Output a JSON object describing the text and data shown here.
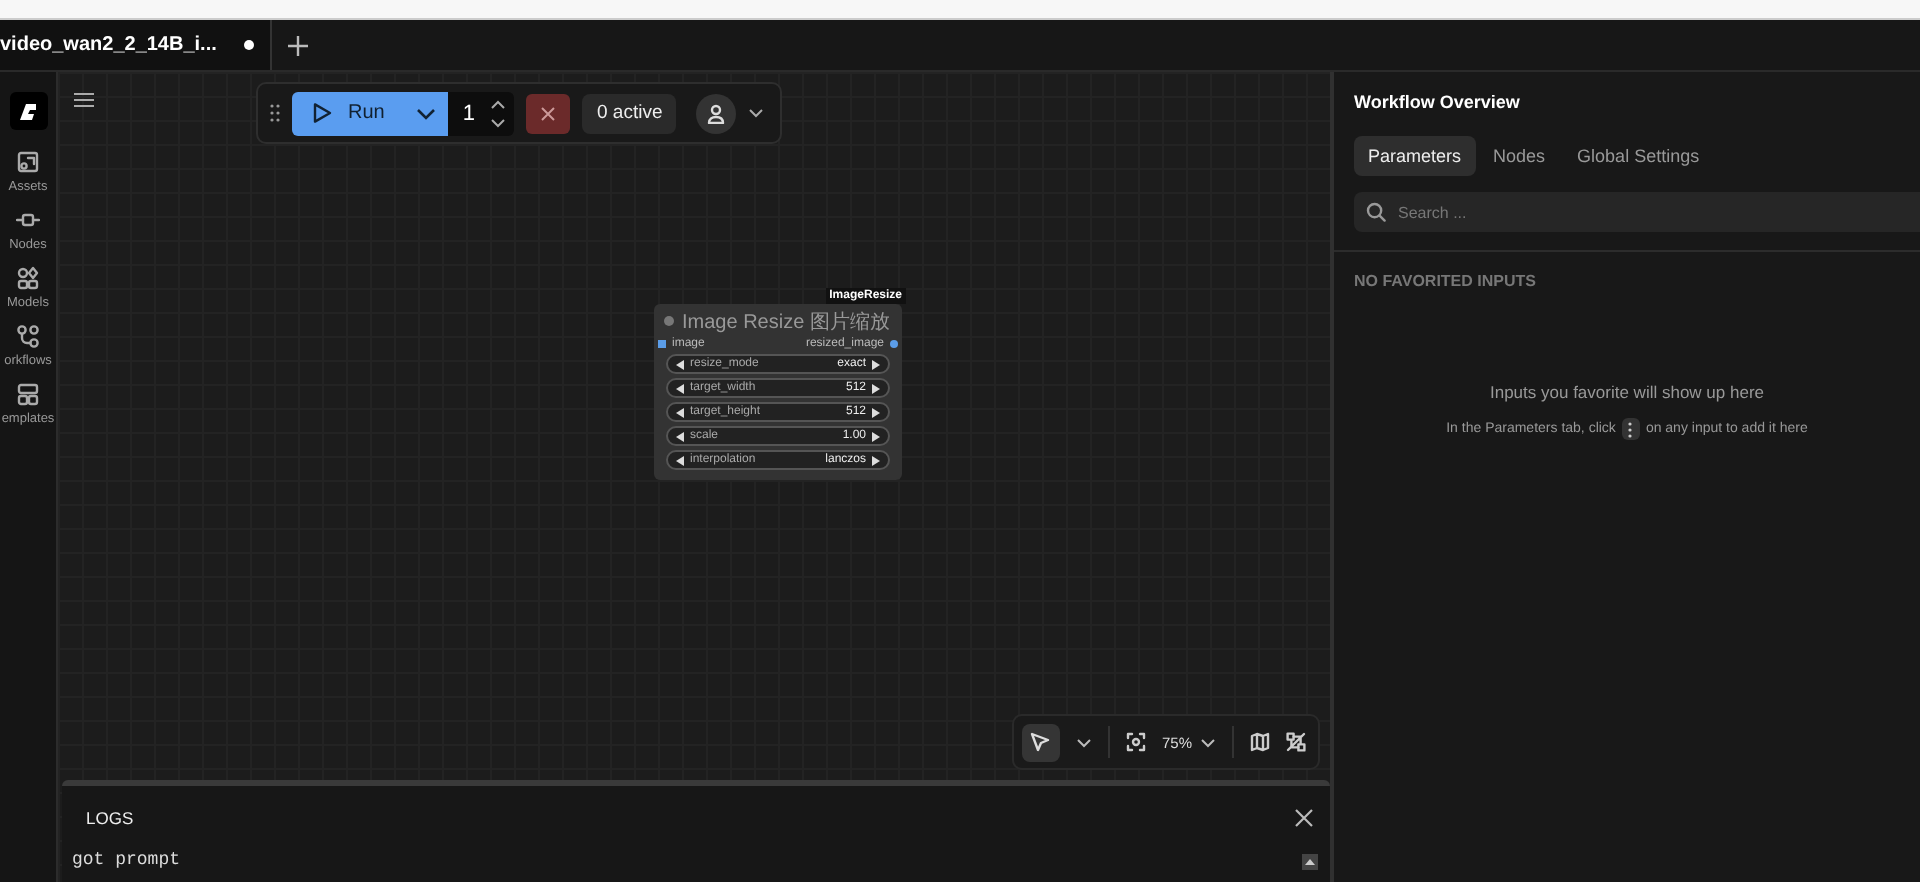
{
  "tabs": [
    {
      "label": "video_wan2_2_14B_i...",
      "selected": true,
      "modified": true
    }
  ],
  "sidebar": {
    "items": [
      {
        "label": "Assets"
      },
      {
        "label": "Nodes"
      },
      {
        "label": "Models"
      },
      {
        "label": "orkflows"
      },
      {
        "label": "emplates"
      }
    ]
  },
  "run_toolbar": {
    "run_label": "Run",
    "count": "1",
    "active": "0 active"
  },
  "node": {
    "badge": "ImageResize",
    "title": "Image Resize 图片缩放",
    "input": "image",
    "output": "resized_image",
    "widgets": [
      {
        "name": "resize_mode",
        "value": "exact"
      },
      {
        "name": "target_width",
        "value": "512"
      },
      {
        "name": "target_height",
        "value": "512"
      },
      {
        "name": "scale",
        "value": "1.00"
      },
      {
        "name": "interpolation",
        "value": "lanczos"
      }
    ]
  },
  "canvas_controls": {
    "zoom": "75%"
  },
  "logs": {
    "title": "LOGS",
    "lines": [
      "got prompt"
    ]
  },
  "panel": {
    "title": "Workflow Overview",
    "tabs": [
      {
        "label": "Parameters",
        "selected": true
      },
      {
        "label": "Nodes",
        "selected": false
      },
      {
        "label": "Global Settings",
        "selected": false
      }
    ],
    "search": {
      "placeholder": "Search ..."
    },
    "section": "NO FAVORITED INPUTS",
    "empty_title": "Inputs you favorite will show up here",
    "hint_before": "In the Parameters tab, click",
    "hint_after": "on any input to add it here"
  }
}
